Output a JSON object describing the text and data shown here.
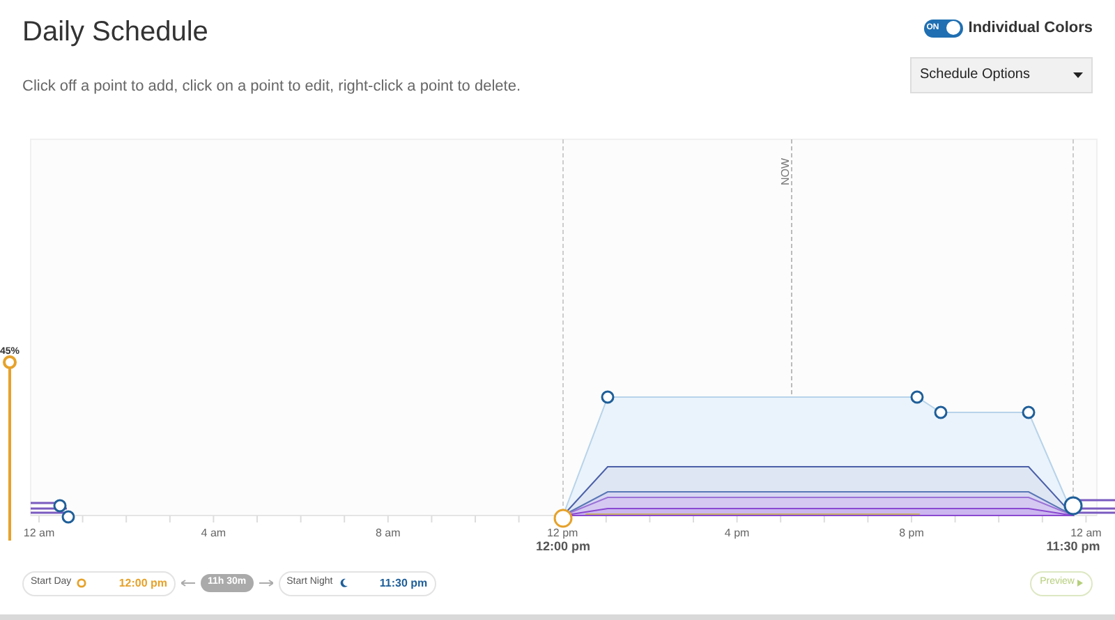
{
  "title": "Daily Schedule",
  "individual_colors": {
    "label": "Individual Colors",
    "on": true,
    "on_text": "ON"
  },
  "hint": "Click off a point to add, click on a point to edit, right-click a point to delete.",
  "schedule_options": {
    "label": "Schedule Options"
  },
  "chart": {
    "now_label": "NOW",
    "x_labels": [
      "12 am",
      "4 am",
      "8 am",
      "12 pm",
      "4 pm",
      "8 pm",
      "12 am"
    ],
    "start_marker": "12:00 pm",
    "end_marker": "11:30 pm"
  },
  "brightness": {
    "label": "45%"
  },
  "start_day": {
    "label": "Start Day",
    "time": "12:00 pm"
  },
  "duration": "11h 30m",
  "start_night": {
    "label": "Start Night",
    "time": "11:30 pm"
  },
  "preview": {
    "label": "Preview"
  }
}
